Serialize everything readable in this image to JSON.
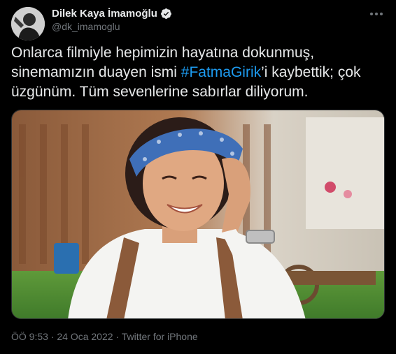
{
  "author": {
    "display_name": "Dilek Kaya İmamoğlu",
    "handle": "@dk_imamoglu",
    "avatar_icon": "profile-photo",
    "verified_icon": "verified-badge-icon"
  },
  "tweet": {
    "text_line1": "Onlarca filmiyle hepimizin hayatına dokunmuş,",
    "text_line2_pre": "sinemamızın duayen ismi ",
    "hashtag": "#FatmaGirik",
    "text_line2_post": "’i kaybettik; çok",
    "text_line3": "üzgünüm. Tüm sevenlerine sabırlar diliyorum.",
    "media_description": "photo",
    "meta": "ÖÖ 9:53 · 24 Oca 2022 · Twitter for iPhone"
  },
  "colors": {
    "background": "#000000",
    "text": "#e7e9ea",
    "secondary": "#71767b",
    "link": "#1d9bf0"
  }
}
